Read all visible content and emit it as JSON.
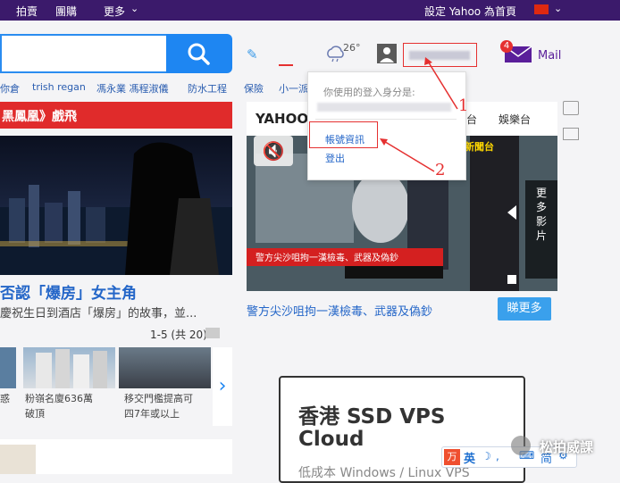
{
  "topbar": {
    "links": [
      "拍賣",
      "團購",
      "更多"
    ],
    "homepage": "設定 Yahoo 為首頁"
  },
  "weather": {
    "temp": "26°"
  },
  "mail": {
    "label": "Mail",
    "badge": "4"
  },
  "trending": [
    "你倉",
    "trish regan",
    "馮永業 馮程淑儀",
    "防水工程",
    "保險",
    "小一派"
  ],
  "news": {
    "banner": "黑鳳凰》戲飛",
    "title": "否認「爆房」女主角",
    "desc": "慶祝生日到酒店「爆房」的故事，並...",
    "pager": "1-5 (共 20)",
    "thumbs": [
      {
        "caption": [
          "惑"
        ]
      },
      {
        "caption": [
          "粉嶺名廈636萬",
          "破頂"
        ]
      },
      {
        "caption": [
          "移交門檻提高可",
          "四7年或以上"
        ]
      }
    ]
  },
  "video": {
    "tabs": [
      "YAHOO",
      "台",
      "娛樂台"
    ],
    "channel": "新聞台",
    "side_label": [
      "更",
      "多",
      "影",
      "片"
    ],
    "subtitle": "警方尖沙咀拘一漢檢毒、武器及偽鈔",
    "headline": "警方尖沙咀拘一漢檢毒、武器及偽鈔",
    "more_button": "睇更多"
  },
  "dropdown": {
    "login_label": "你使用的登入身分是:",
    "account_link": "帳號資訊",
    "logout": "登出"
  },
  "annotations": [
    "1",
    "2"
  ],
  "ad": {
    "title_line1": "香港 SSD VPS",
    "title_line2": "Cloud",
    "sub": "低成本 Windows / Linux VPS"
  },
  "ime": {
    "lang": "英",
    "simp": "简"
  },
  "watermark": "松拍威課",
  "colors": {
    "topbar": "#3b1a6b",
    "search": "#1e86f2",
    "banner": "#e02b2b",
    "annotation": "#e53030"
  }
}
